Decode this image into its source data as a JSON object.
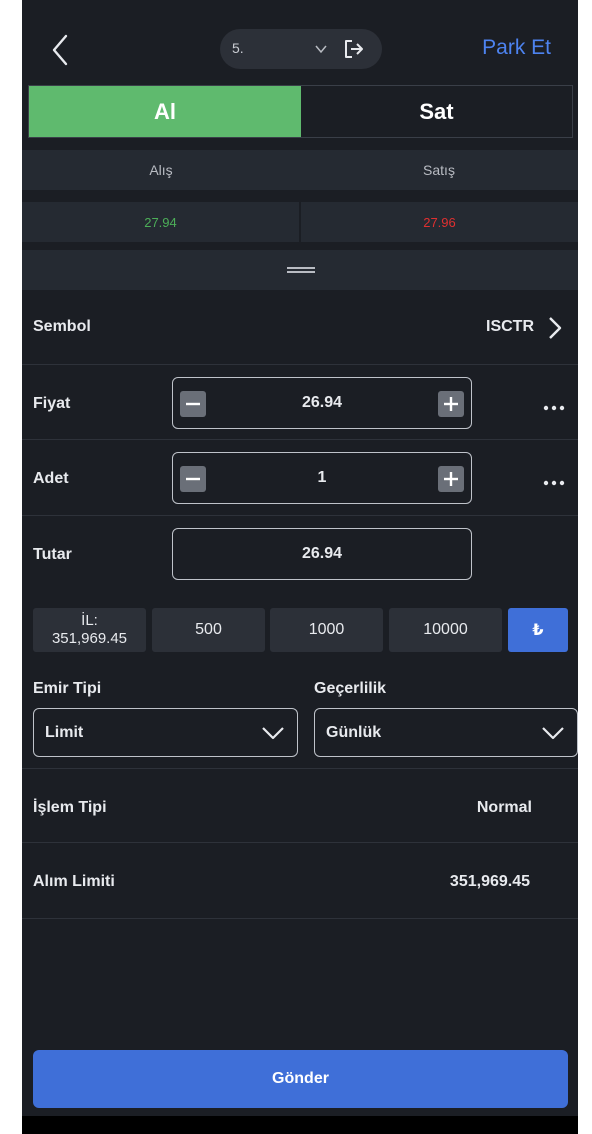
{
  "header": {
    "account_value": "5.",
    "park_label": "Park Et"
  },
  "tabs": {
    "buy": "Al",
    "sell": "Sat"
  },
  "prices": {
    "bid_label": "Alış",
    "ask_label": "Satış",
    "bid_value": "27.94",
    "ask_value": "27.96"
  },
  "symbol": {
    "label": "Sembol",
    "value": "ISCTR"
  },
  "price": {
    "label": "Fiyat",
    "value": "26.94"
  },
  "quantity": {
    "label": "Adet",
    "value": "1"
  },
  "amount": {
    "label": "Tutar",
    "value": "26.94"
  },
  "quick_amounts": {
    "limit_label": "İL:",
    "limit_value": "351,969.45",
    "items": [
      "500",
      "1000",
      "10000"
    ],
    "currency": "₺"
  },
  "order_type": {
    "label": "Emir Tipi",
    "value": "Limit"
  },
  "validity": {
    "label": "Geçerlilik",
    "value": "Günlük"
  },
  "transaction_type": {
    "label": "İşlem Tipi",
    "value": "Normal"
  },
  "buy_limit": {
    "label": "Alım Limiti",
    "value": "351,969.45"
  },
  "submit_label": "Gönder",
  "colors": {
    "background": "#1b1e24",
    "buy_green": "#5fba6e",
    "bid_green": "#4cae58",
    "ask_red": "#e03030",
    "accent_blue": "#3f6fd8",
    "link_blue": "#4d83f0"
  }
}
